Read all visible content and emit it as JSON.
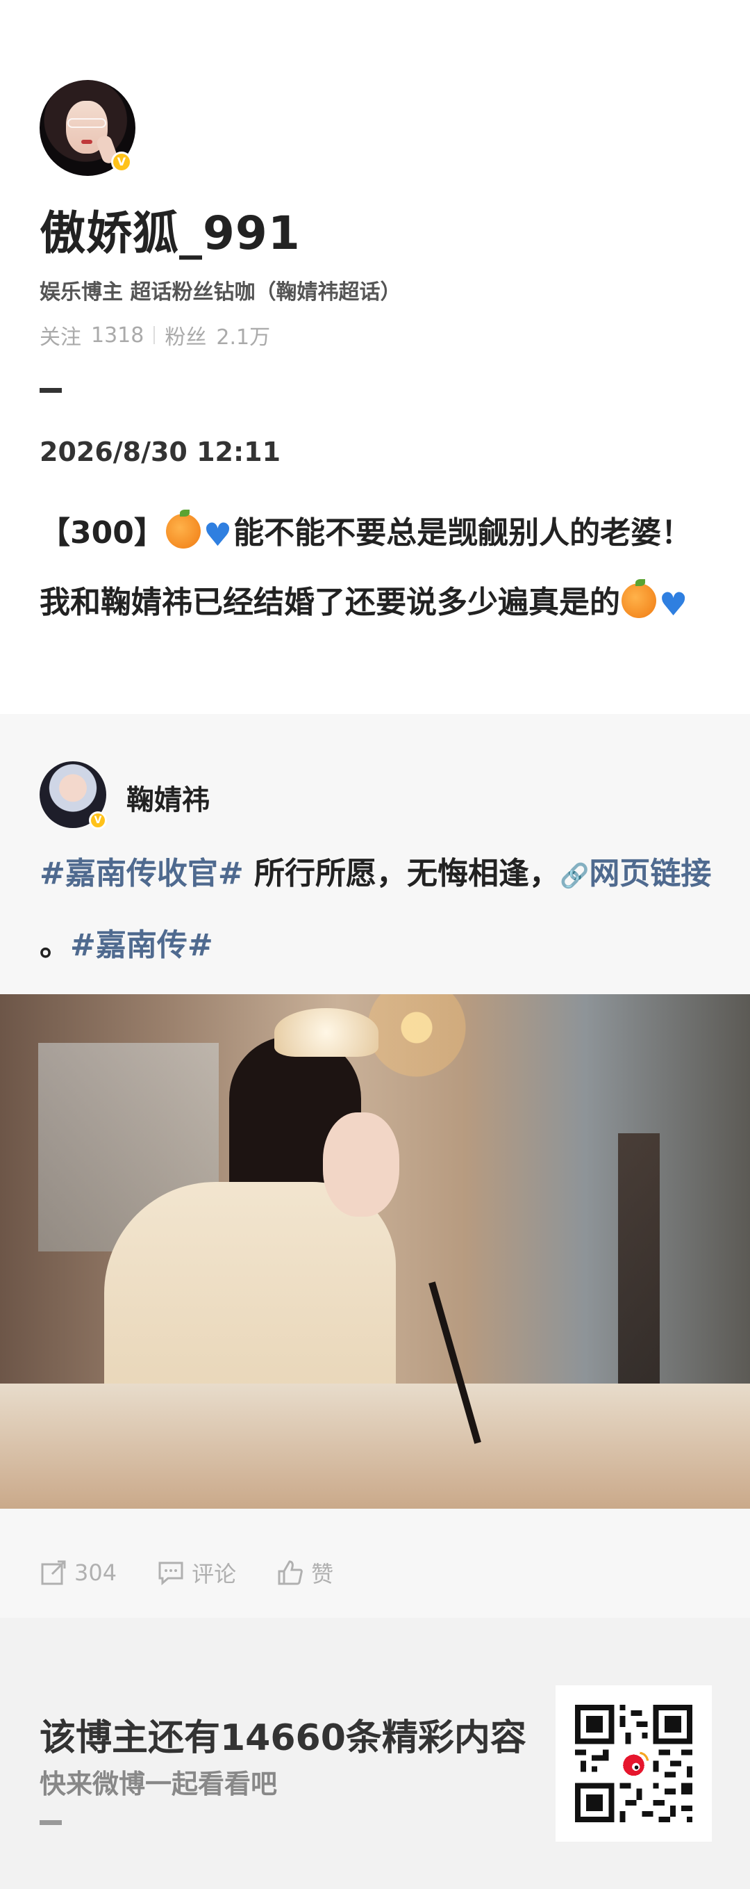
{
  "watermark": "微博",
  "profile": {
    "username": "傲娇狐_991",
    "subtitle": "娱乐博主 超话粉丝钻咖（鞠婧祎超话）",
    "following_label": "关注",
    "following_count": "1318",
    "followers_label": "粉丝",
    "followers_count": "2.1万",
    "verified_badge": "V"
  },
  "post": {
    "time": "2026/8/30 12:11",
    "text_prefix": "【300】",
    "text_body": "能不能不要总是觊觎别人的老婆！我和鞠婧祎已经结婚了还要说多少遍真是的",
    "emoji_1": "orange-emoji",
    "emoji_2": "blue-heart-emoji"
  },
  "repost": {
    "author": "鞠婧祎",
    "verified_badge": "V",
    "tag_1": "#嘉南传收官#",
    "text_mid": " 所行所愿，无悔相逢，",
    "link_icon": "🔗",
    "link_label": "网页链接",
    "text_end": " 。",
    "tag_2": "#嘉南传#",
    "image_alt": "woman in traditional hanfu writing calligraphy with brush"
  },
  "actions": {
    "repost_count": "304",
    "comment_label": "评论",
    "like_label": "赞"
  },
  "promo": {
    "title": "该博主还有14660条精彩内容",
    "subtitle": "快来微博一起看看吧"
  },
  "colors": {
    "tag_blue": "#4f6a8f",
    "badge_yellow": "#ffc21a",
    "muted_grey": "#b0b0b0"
  }
}
